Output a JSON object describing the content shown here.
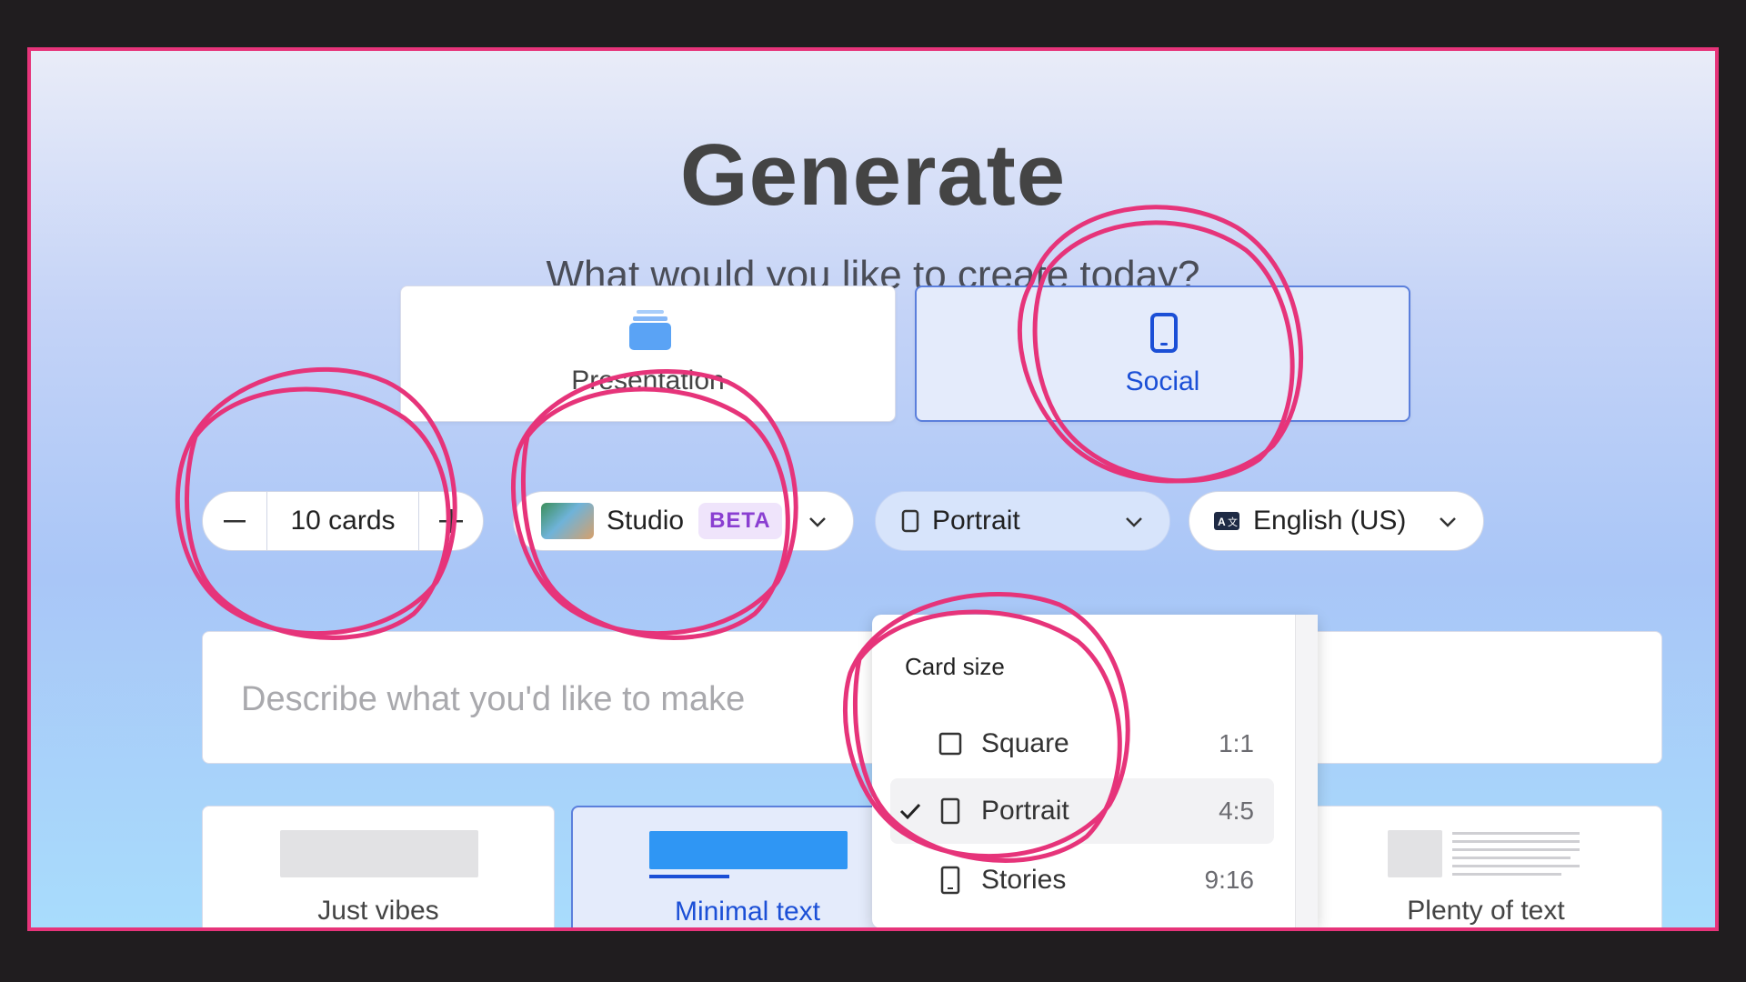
{
  "header": {
    "title": "Generate",
    "subtitle": "What would you like to create today?"
  },
  "content_types": [
    {
      "label": "Presentation",
      "icon": "stack-icon",
      "selected": false
    },
    {
      "label": "Social",
      "icon": "phone-icon",
      "selected": true
    }
  ],
  "controls": {
    "cards_value": "10 cards",
    "minus_icon": "minus-icon",
    "plus_icon": "plus-icon",
    "studio_label": "Studio",
    "studio_badge": "BETA",
    "format_label": "Portrait",
    "language_label": "English (US)"
  },
  "prompt": {
    "placeholder": "Describe what you'd like to make"
  },
  "card_size_menu": {
    "heading": "Card size",
    "options": [
      {
        "label": "Square",
        "ratio": "1:1",
        "selected": false
      },
      {
        "label": "Portrait",
        "ratio": "4:5",
        "selected": true
      },
      {
        "label": "Stories",
        "ratio": "9:16",
        "selected": false
      }
    ]
  },
  "text_amount": [
    {
      "label": "Just vibes",
      "selected": false
    },
    {
      "label": "Minimal text",
      "selected": true
    },
    {
      "label": "",
      "selected": false
    },
    {
      "label": "Plenty of text",
      "selected": false
    }
  ],
  "colors": {
    "accent": "#1b4fd6",
    "annotation": "#e6347a",
    "beta_bg": "#efe4fb",
    "beta_text": "#8a3fd1"
  }
}
